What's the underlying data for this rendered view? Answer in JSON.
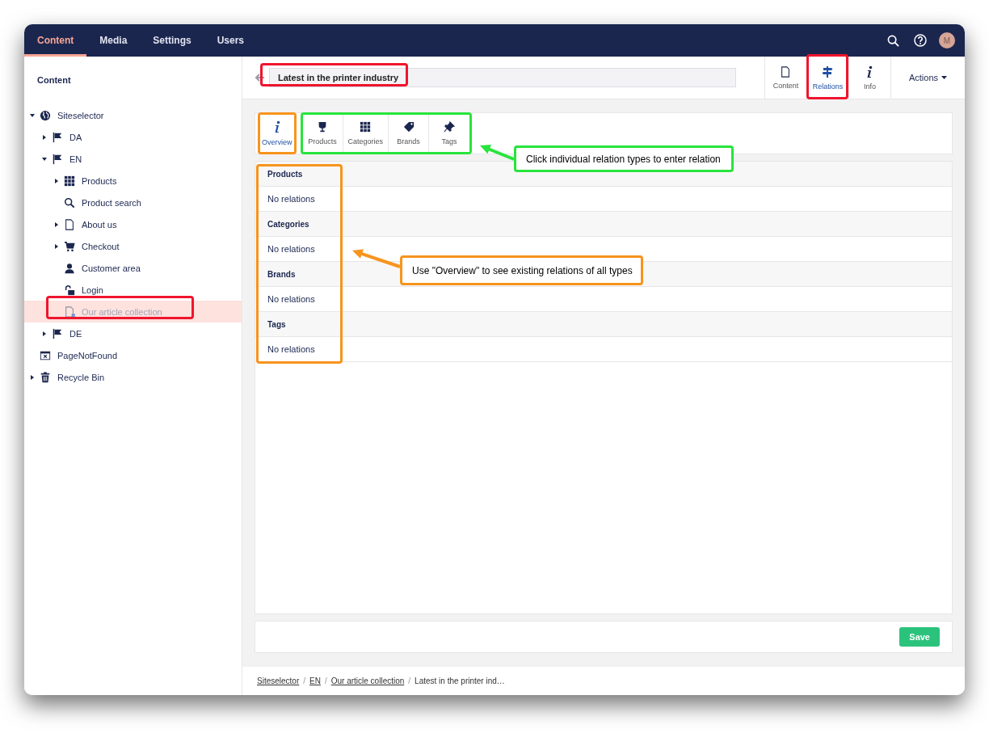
{
  "top_nav": {
    "items": [
      {
        "label": "Content",
        "selected": true
      },
      {
        "label": "Media",
        "selected": false
      },
      {
        "label": "Settings",
        "selected": false
      },
      {
        "label": "Users",
        "selected": false
      }
    ],
    "avatar": "M"
  },
  "sidebar": {
    "title": "Content",
    "tree": [
      {
        "label": "Siteselector",
        "kind": "site",
        "expanded": true,
        "selected": false,
        "children": [
          {
            "label": "DA",
            "kind": "language",
            "expanded": false,
            "selected": false
          },
          {
            "label": "EN",
            "kind": "language",
            "expanded": true,
            "selected": false,
            "children": [
              {
                "label": "Products",
                "kind": "catalog",
                "expanded": false,
                "selected": false
              },
              {
                "label": "Product search",
                "kind": "search",
                "selected": false
              },
              {
                "label": "About us",
                "kind": "page",
                "expanded": false,
                "selected": false
              },
              {
                "label": "Checkout",
                "kind": "cart",
                "expanded": false,
                "selected": false
              },
              {
                "label": "Customer area",
                "kind": "account",
                "selected": false
              },
              {
                "label": "Login",
                "kind": "login",
                "selected": false
              },
              {
                "label": "Our article collection",
                "kind": "article",
                "selected": true
              }
            ]
          },
          {
            "label": "DE",
            "kind": "language",
            "expanded": false,
            "selected": false
          }
        ]
      },
      {
        "label": "PageNotFound",
        "kind": "error",
        "selected": false
      },
      {
        "label": "Recycle Bin",
        "kind": "bin",
        "expanded": false,
        "selected": false
      }
    ]
  },
  "editor": {
    "title_field": {
      "value": "Latest in the printer industry"
    },
    "view_tabs": [
      {
        "label": "Content",
        "kind": "page",
        "selected": false
      },
      {
        "label": "Relations",
        "kind": "relations",
        "selected": true
      },
      {
        "label": "Info",
        "kind": "info",
        "selected": false
      }
    ],
    "actions": "Actions"
  },
  "relation_tabs": [
    {
      "label": "Overview",
      "kind": "info",
      "selected": true
    },
    {
      "label": "Products",
      "kind": "glass",
      "selected": false
    },
    {
      "label": "Categories",
      "kind": "grid",
      "selected": false
    },
    {
      "label": "Brands",
      "kind": "tag",
      "selected": false
    },
    {
      "label": "Tags",
      "kind": "pin",
      "selected": false
    }
  ],
  "sections": [
    {
      "title": "Products",
      "text": "No relations"
    },
    {
      "title": "Categories",
      "text": "No relations"
    },
    {
      "title": "Brands",
      "text": "No relations"
    },
    {
      "title": "Tags",
      "text": "No relations"
    }
  ],
  "save_button": "Save",
  "breadcrumb_separator": "/",
  "breadcrumb": [
    {
      "label": "Siteselector",
      "kind": "link"
    },
    {
      "label": "EN",
      "kind": "link"
    },
    {
      "label": "Our article collection",
      "kind": "link"
    },
    {
      "label": "Latest in the printer ind…",
      "kind": "current"
    }
  ],
  "highlights": [
    {
      "color": "#f0142d"
    },
    {
      "color": "#f0142d"
    },
    {
      "color": "#f0142d"
    },
    {
      "color": "#f7941d"
    },
    {
      "color": "#28e43c"
    },
    {
      "color": "#f7941d"
    }
  ],
  "callouts": [
    {
      "text": "Click individual relation types to enter relation",
      "color": "#28e43c"
    },
    {
      "text": "Use \"Overview\" to see existing relations of all types",
      "color": "#f7941d"
    }
  ]
}
